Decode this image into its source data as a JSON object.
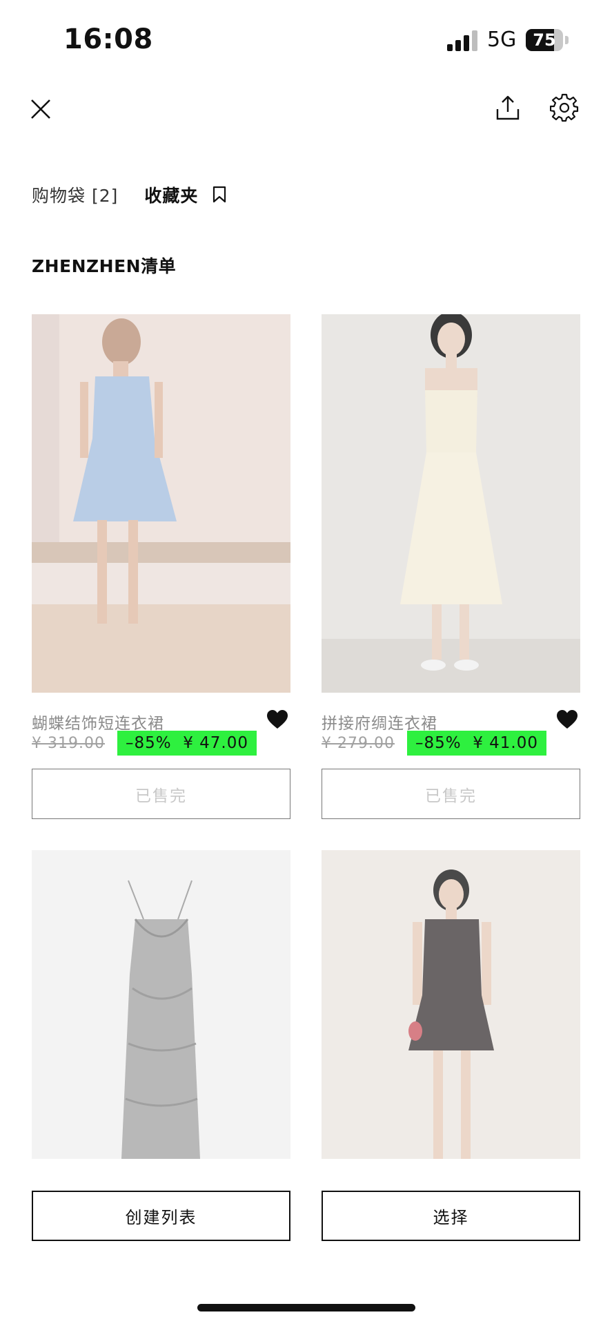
{
  "status_bar": {
    "time": "16:08",
    "network": "5G",
    "battery": "75",
    "battery_level": 0.75
  },
  "toolbar": {
    "close_icon": "close-icon",
    "share_icon": "share-icon",
    "settings_icon": "gear-icon"
  },
  "tabs": {
    "bag_label": "购物袋 [2]",
    "favorites_label": "收藏夹",
    "bookmark_icon": "bookmark-icon"
  },
  "list": {
    "title": "ZHENZHEN清单"
  },
  "products": [
    {
      "name": "蝴蝶结饰短连衣裙",
      "old_price": "¥ 319.00",
      "discount": "–85%",
      "sale_price": "¥ 47.00",
      "status": "已售完",
      "favorited": true
    },
    {
      "name": "拼接府绸连衣裙",
      "old_price": "¥ 279.00",
      "discount": "–85%",
      "sale_price": "¥ 41.00",
      "status": "已售完",
      "favorited": true
    },
    {
      "name": "",
      "old_price": "",
      "discount": "",
      "sale_price": "",
      "status": "",
      "favorited": true
    },
    {
      "name": "",
      "old_price": "",
      "discount": "",
      "sale_price": "",
      "status": "",
      "favorited": true
    }
  ],
  "actions": {
    "create_list": "创建列表",
    "select": "选择"
  },
  "colors": {
    "sale_tag": "#2ef03f",
    "text": "#111111",
    "muted": "#8a8a8a"
  }
}
